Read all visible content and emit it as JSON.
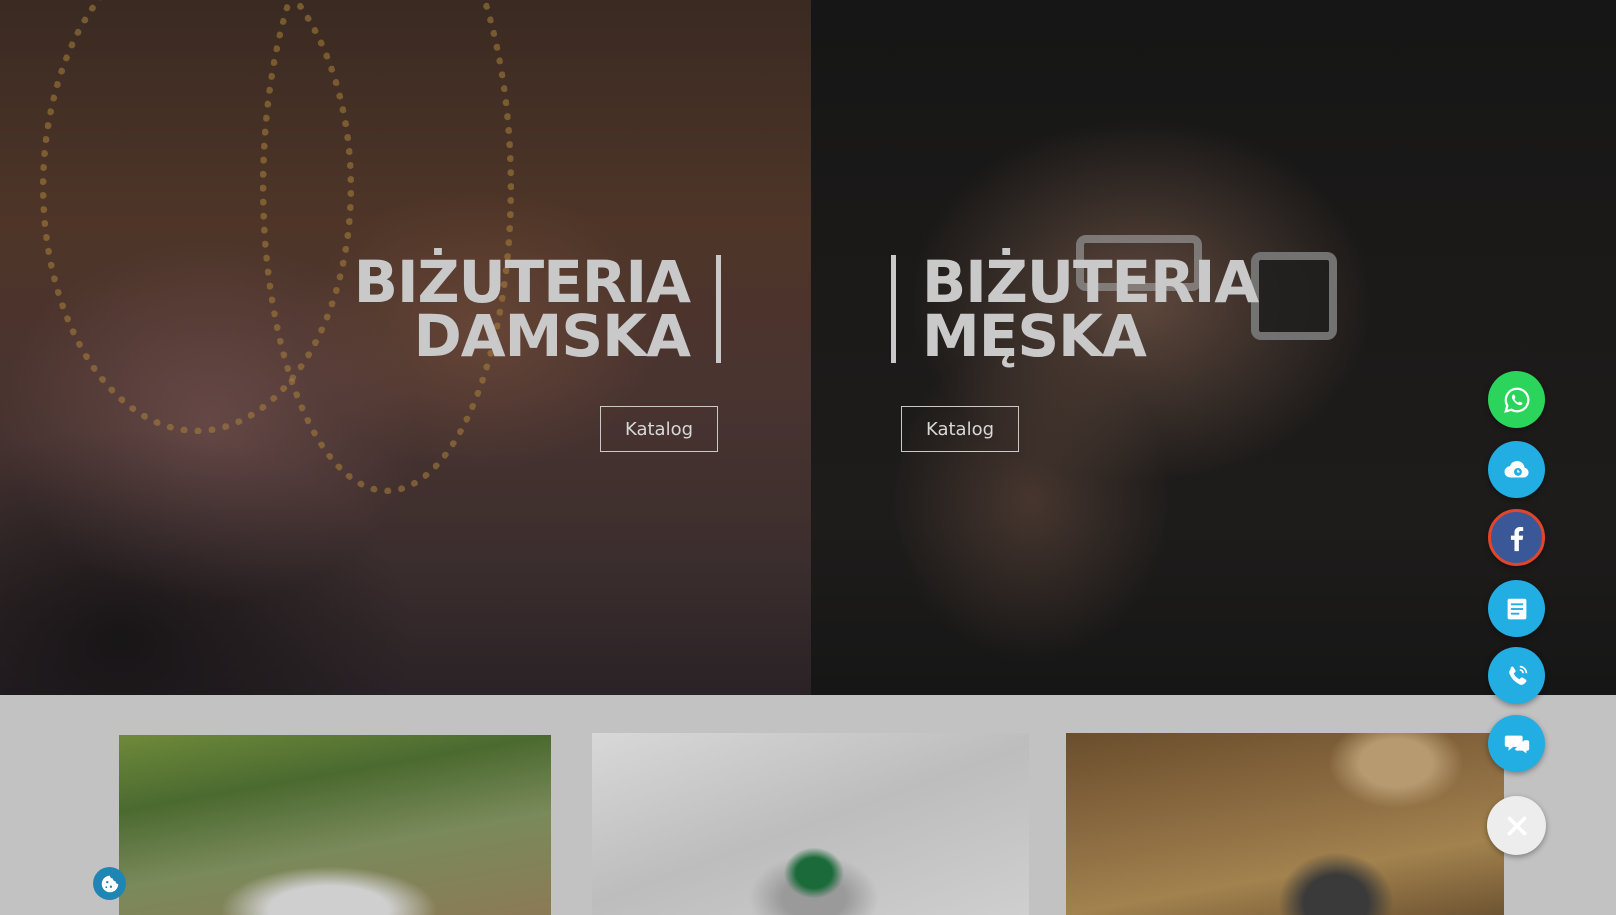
{
  "hero": {
    "left": {
      "title_line1": "BIŻUTERIA",
      "title_line2": "DAMSKA",
      "button_label": "Katalog"
    },
    "right": {
      "title_line1": "BIŻUTERIA",
      "title_line2": "MĘSKA",
      "button_label": "Katalog"
    }
  },
  "floating_contact": {
    "items": [
      {
        "icon": "whatsapp-icon",
        "color": "#2bd45a"
      },
      {
        "icon": "cloud-clock-icon",
        "color": "#22aee3"
      },
      {
        "icon": "facebook-icon",
        "color": "#3a5897"
      },
      {
        "icon": "form-icon",
        "color": "#22aee3"
      },
      {
        "icon": "phone-icon",
        "color": "#22aee3"
      },
      {
        "icon": "chat-icon",
        "color": "#22aee3"
      },
      {
        "icon": "close-icon",
        "color": "#ededed"
      }
    ]
  },
  "cookie_button": {
    "icon": "cookie-icon",
    "color": "#1f86b3"
  }
}
